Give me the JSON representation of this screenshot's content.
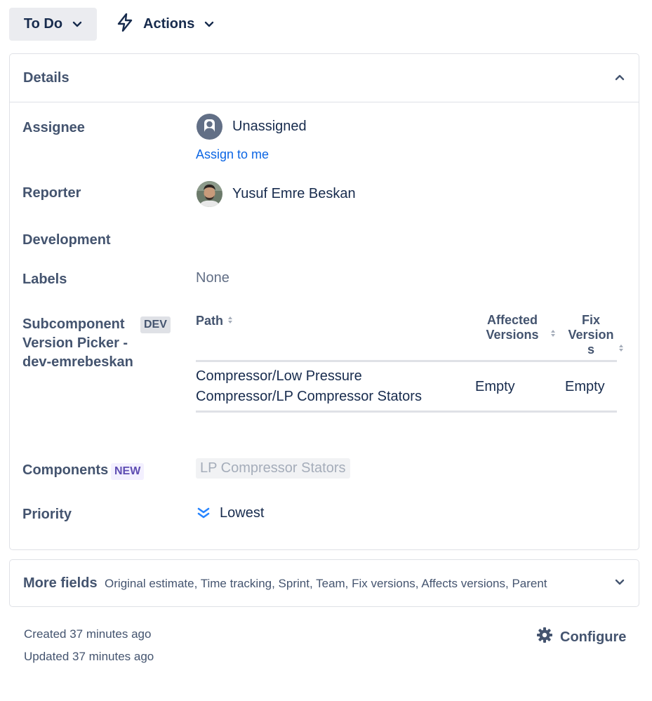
{
  "toolbar": {
    "status_label": "To Do",
    "actions_label": "Actions"
  },
  "details": {
    "title": "Details",
    "assignee": {
      "label": "Assignee",
      "value": "Unassigned",
      "assign_link": "Assign to me"
    },
    "reporter": {
      "label": "Reporter",
      "value": "Yusuf Emre Beskan"
    },
    "development": {
      "label": "Development"
    },
    "labels": {
      "label": "Labels",
      "value": "None"
    },
    "subcomponent": {
      "label_line1": "Subcomponent",
      "label_line2": "Version Picker -",
      "label_line3": "dev-emrebeskan",
      "badge": "DEV",
      "table": {
        "headers": {
          "path": "Path",
          "affected_line1": "Affected",
          "affected_line2": "Versions",
          "fix_line1": "Fix",
          "fix_line2": "Version",
          "fix_line3": "s"
        },
        "rows": [
          {
            "path_line1": "Compressor/Low Pressure",
            "path_line2": "Compressor/LP Compressor Stators",
            "affected": "Empty",
            "fix": "Empty"
          }
        ]
      }
    },
    "components": {
      "label": "Components",
      "badge": "NEW",
      "value": "LP Compressor Stators"
    },
    "priority": {
      "label": "Priority",
      "value": "Lowest"
    }
  },
  "more_fields": {
    "title": "More fields",
    "description": "Original estimate, Time tracking, Sprint, Team, Fix versions, Affects versions, Parent"
  },
  "footer": {
    "created": "Created 37 minutes ago",
    "updated": "Updated 37 minutes ago",
    "configure_label": "Configure"
  },
  "colors": {
    "link": "#0c66e4",
    "priority_icon": "#2684ff",
    "label_text": "#44546f",
    "text": "#172b4d"
  }
}
